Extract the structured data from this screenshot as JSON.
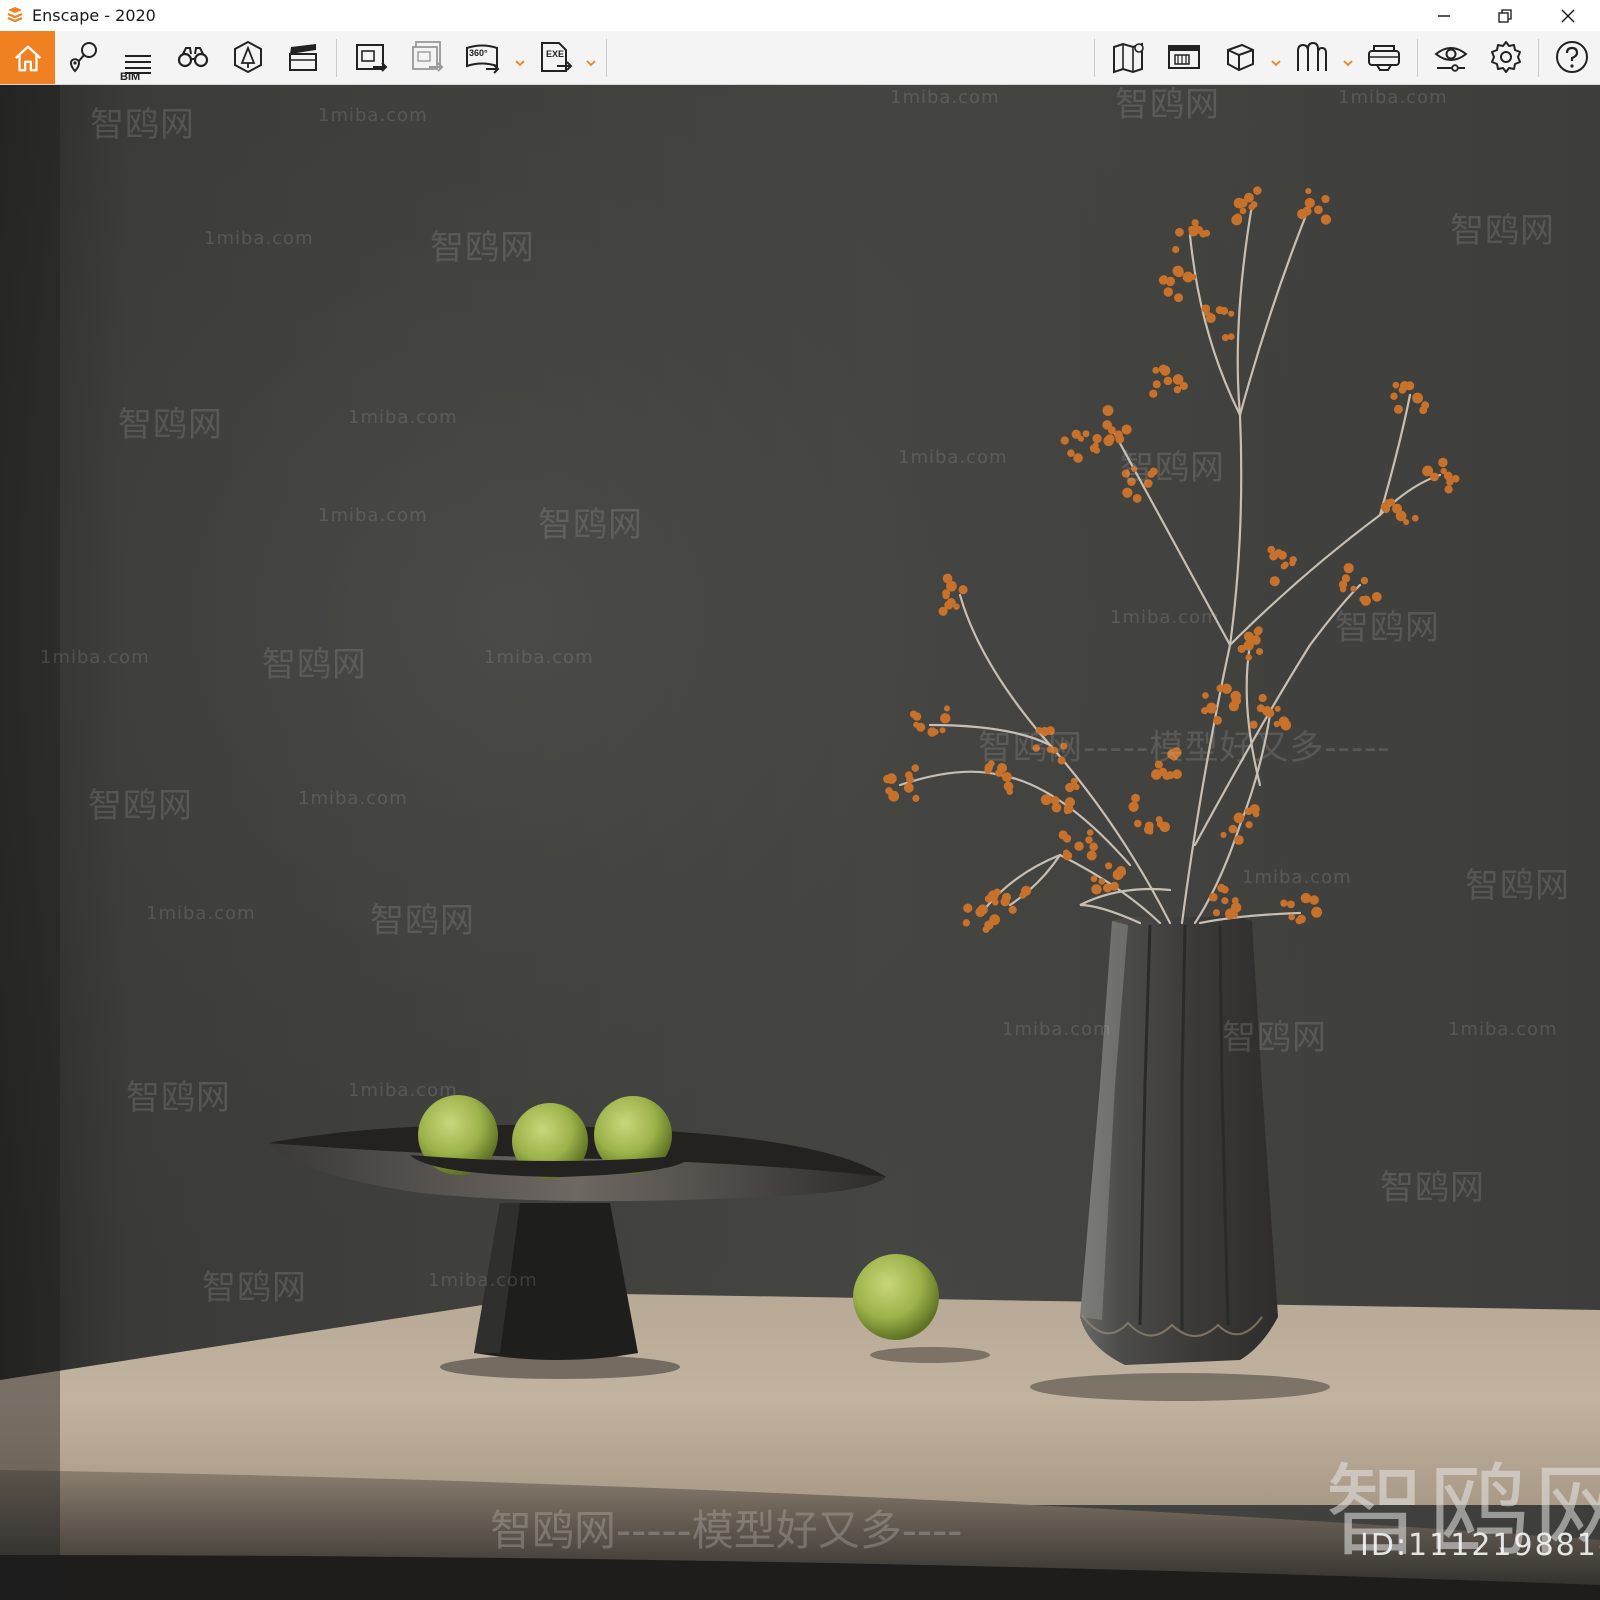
{
  "window": {
    "title": "Enscape - 2020",
    "logo_icon": "enscape-logo-icon",
    "controls": {
      "minimize": "minimize-icon",
      "restore": "restore-icon",
      "close": "close-icon"
    }
  },
  "toolbar": {
    "accent": "#f08020",
    "bim_label": "BIM",
    "left_tools": [
      "home-icon",
      "views-icon",
      "bim-icon",
      "binoculars-icon",
      "atmosphere-icon",
      "video-editor-icon",
      "screenshot-export-icon",
      "batch-render-icon",
      "panorama-360-icon",
      "exe-export-icon"
    ],
    "panorama_label": "360°",
    "exe_label": "EXE",
    "right_tools": [
      "map-icon",
      "presentation-icon",
      "cube-icon",
      "asset-library-icon",
      "vr-headset-icon",
      "visual-settings-icon",
      "settings-icon",
      "help-icon"
    ]
  },
  "watermarks": {
    "site_short": "1miba.com",
    "brand": "智鸥网",
    "slogan": "智鸥网-----模型好又多-----",
    "bottom_slogan": "智鸥网-----模型好又多----",
    "big_brand": "智鸥网",
    "id_label": "ID:111219881"
  }
}
